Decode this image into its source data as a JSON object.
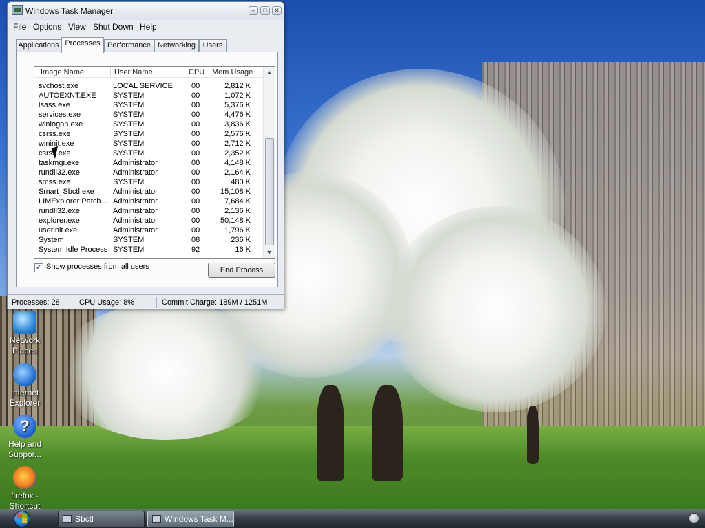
{
  "window": {
    "title": "Windows Task Manager",
    "minimize_glyph": "–",
    "maximize_glyph": "□",
    "close_glyph": "✕"
  },
  "menu": [
    "File",
    "Options",
    "View",
    "Shut Down",
    "Help"
  ],
  "tabs": [
    "Applications",
    "Processes",
    "Performance",
    "Networking",
    "Users"
  ],
  "active_tab": "Processes",
  "columns": {
    "image_name": "Image Name",
    "user_name": "User Name",
    "cpu": "CPU",
    "mem_usage": "Mem Usage"
  },
  "processes": [
    {
      "image": "svchost.exe",
      "user": "LOCAL SERVICE",
      "cpu": "00",
      "mem": "2,812 K"
    },
    {
      "image": "AUTOEXNT.EXE",
      "user": "SYSTEM",
      "cpu": "00",
      "mem": "1,072 K"
    },
    {
      "image": "lsass.exe",
      "user": "SYSTEM",
      "cpu": "00",
      "mem": "5,376 K"
    },
    {
      "image": "services.exe",
      "user": "SYSTEM",
      "cpu": "00",
      "mem": "4,476 K"
    },
    {
      "image": "winlogon.exe",
      "user": "SYSTEM",
      "cpu": "00",
      "mem": "3,836 K"
    },
    {
      "image": "csrss.exe",
      "user": "SYSTEM",
      "cpu": "00",
      "mem": "2,576 K"
    },
    {
      "image": "wininit.exe",
      "user": "SYSTEM",
      "cpu": "00",
      "mem": "2,712 K"
    },
    {
      "image": "csrss.exe",
      "user": "SYSTEM",
      "cpu": "00",
      "mem": "2,352 K"
    },
    {
      "image": "taskmgr.exe",
      "user": "Administrator",
      "cpu": "00",
      "mem": "4,148 K"
    },
    {
      "image": "rundll32.exe",
      "user": "Administrator",
      "cpu": "00",
      "mem": "2,164 K"
    },
    {
      "image": "smss.exe",
      "user": "SYSTEM",
      "cpu": "00",
      "mem": "480 K"
    },
    {
      "image": "Smart_Sbctl.exe",
      "user": "Administrator",
      "cpu": "00",
      "mem": "15,108 K"
    },
    {
      "image": "LIMExplorer Patch...",
      "user": "Administrator",
      "cpu": "00",
      "mem": "7,684 K"
    },
    {
      "image": "rundll32.exe",
      "user": "Administrator",
      "cpu": "00",
      "mem": "2,136 K"
    },
    {
      "image": "explorer.exe",
      "user": "Administrator",
      "cpu": "00",
      "mem": "50,148 K"
    },
    {
      "image": "userinit.exe",
      "user": "Administrator",
      "cpu": "00",
      "mem": "1,796 K"
    },
    {
      "image": "System",
      "user": "SYSTEM",
      "cpu": "08",
      "mem": "236 K"
    },
    {
      "image": "System Idle Process",
      "user": "SYSTEM",
      "cpu": "92",
      "mem": "16 K"
    }
  ],
  "show_all_processes": {
    "label": "Show processes from all users",
    "checked": true,
    "check_glyph": "✓"
  },
  "end_process_label": "End Process",
  "status": {
    "processes": "Processes: 28",
    "cpu_usage": "CPU Usage: 8%",
    "commit_charge": "Commit Charge: 189M / 1251M"
  },
  "desktop_icons": [
    {
      "label": "Network Places",
      "icon": "network-places-icon"
    },
    {
      "label": "Internet Explorer",
      "icon": "internet-explorer-icon"
    },
    {
      "label": "Help and Suppor...",
      "icon": "help-icon"
    },
    {
      "label": "firefox - Shortcut",
      "icon": "firefox-icon"
    }
  ],
  "taskbar": {
    "buttons": [
      {
        "label": "Sbctl",
        "active": false
      },
      {
        "label": "Windows Task M...",
        "active": true
      }
    ]
  }
}
